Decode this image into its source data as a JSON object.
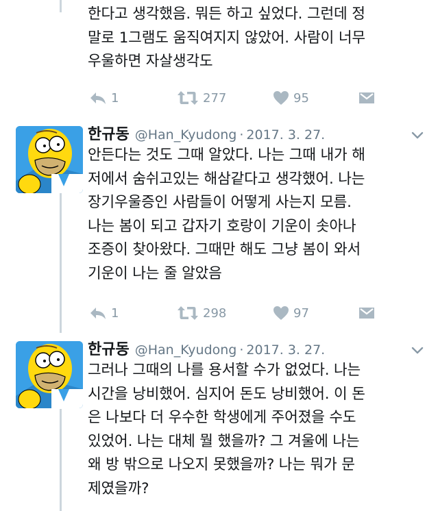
{
  "tweets": [
    {
      "text_lines": [
        "한다고 생각했음. 뭐든 하고 싶었다. 그런데 정",
        "말로 1그램도 움직여지지 않았어. 사람이 너무",
        "우울하면 자살생각도"
      ],
      "replies": "1",
      "retweets": "277",
      "likes": "95"
    },
    {
      "name": "한규동",
      "handle": "@Han_Kyudong",
      "separator": "·",
      "date": "2017. 3. 27.",
      "text_lines": [
        "안든다는 것도 그때 알았다. 나는 그때 내가 해",
        "저에서 숨쉬고있는 해삼같다고 생각했어. 나는",
        "장기우울증인 사람들이 어떻게 사는지 모름.",
        "나는 봄이 되고 갑자기 호랑이 기운이 솟아나",
        "조증이 찾아왔다. 그때만 해도 그냥 봄이 와서",
        "기운이 나는 줄 알았음"
      ],
      "replies": "1",
      "retweets": "298",
      "likes": "97"
    },
    {
      "name": "한규동",
      "handle": "@Han_Kyudong",
      "separator": "·",
      "date": "2017. 3. 27.",
      "text_lines": [
        "그러나 그때의 나를 용서할 수가 없었다. 나는",
        "시간을 낭비했어. 심지어 돈도 낭비했어. 이 돈",
        "은 나보다 더 우수한 학생에게 주어졌을 수도",
        "있었어. 나는 대체 뭘 했을까? 그 겨울에 나는",
        "왜 방 밖으로 나오지 못했을까? 나는 뭐가 문",
        "제였을까?"
      ]
    }
  ],
  "icons": {
    "reply": "reply-icon",
    "retweet": "retweet-icon",
    "like": "heart-icon",
    "dm": "envelope-icon",
    "more": "chevron-down-icon"
  },
  "colors": {
    "action_gray": "#aab8c2",
    "count_gray": "#8899a6",
    "meta_gray": "#657786",
    "thread_line": "#ccd6dd",
    "avatar_bg": "#3aa0e6"
  }
}
